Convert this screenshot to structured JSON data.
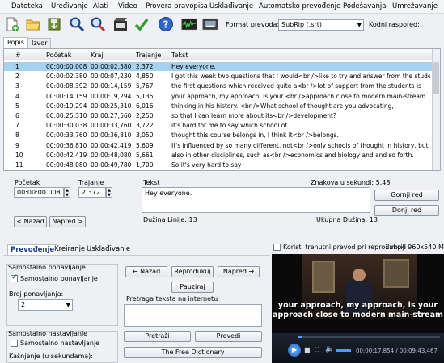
{
  "menu": [
    "Datoteka",
    "Uređivanje",
    "Alati",
    "Video",
    "Provera pravopisa",
    "Usklađivanje",
    "Automatsko prevođenje",
    "Podešavanja",
    "Umrežavanje"
  ],
  "toolbar": {
    "format_label": "Format prevoda:",
    "format_value": "SubRip (.srt)",
    "encoding_label": "Kodni raspored:",
    "icons": [
      "new-file-icon",
      "open-folder-icon",
      "save-icon",
      "find-icon",
      "replace-icon",
      "visual-sync-icon",
      "spell-check-icon",
      "help-icon",
      "waveform-icon",
      "video-icon"
    ]
  },
  "tabs": {
    "list": "Popis",
    "source": "Izvor"
  },
  "grid": {
    "headers": [
      "#",
      "Početak",
      "Kraj",
      "Trajanje",
      "Tekst"
    ],
    "rows": [
      [
        "1",
        "00:00:00,008",
        "00:00:02,380",
        "2,372",
        "Hey everyone."
      ],
      [
        "2",
        "00:00:02,380",
        "00:00:07,230",
        "4,850",
        "I got this week two questions that I would<br />like to try and answer from the students."
      ],
      [
        "3",
        "00:00:08,392",
        "00:00:14,159",
        "5,767",
        "the first questions which received quite a<br />lot of support from the students is"
      ],
      [
        "4",
        "00:00:14,159",
        "00:00:19,294",
        "5,135",
        "your approach, my approach, is your <br />approach close to modern main-stream"
      ],
      [
        "5",
        "00:00:19,294",
        "00:00:25,310",
        "6,016",
        "thinking in his history. <br />What school of thought are you advocating,"
      ],
      [
        "6",
        "00:00:25,310",
        "00:00:27,560",
        "2,250",
        "so that I can learn more about its<br />development?"
      ],
      [
        "7",
        "00:00:30,038",
        "00:00:33,760",
        "3,722",
        "it's hard for me to say which school of"
      ],
      [
        "8",
        "00:00:33,760",
        "00:00:36,810",
        "3,050",
        "thought this course belongs in, I think it<br />belongs."
      ],
      [
        "9",
        "00:00:36,810",
        "00:00:42,419",
        "5,609",
        "It's influenced by so many different, not<br />only schools of thought in history, but"
      ],
      [
        "10",
        "00:00:42,419",
        "00:00:48,080",
        "5,661",
        "also in other disciplines, such as<br />economics and biology and and so forth."
      ],
      [
        "11",
        "00:00:48,080",
        "00:00:49,780",
        "1,700",
        "So it's very hard to say"
      ]
    ]
  },
  "editor": {
    "start_label": "Početak",
    "start_value": "00:00:00.008",
    "duration_label": "Trajanje",
    "duration_value": "2.372",
    "text_label": "Tekst",
    "cps": "Znakova u sekundi: 5.48",
    "text_value": "Hey everyone.",
    "line_length": "Dužina Linije:  13",
    "total_length": "Ukupna Dužina:  13",
    "prev": "< Nazad",
    "next": "Napred >",
    "upper_row": "Gornji red",
    "lower_row": "Donji red"
  },
  "lower_tabs": [
    "Prevođenje",
    "Kreiranje",
    "Usklađivanje"
  ],
  "translate": {
    "repeat_group": "Samostalno ponavljanje",
    "repeat_check": "Samostalno ponavljanje",
    "repeat_count_label": "Broj ponavljanja:",
    "repeat_count": "2",
    "continue_group": "Samostalno nastavljanje",
    "continue_check": "Samostalno nastavljanje",
    "delay_label": "Kašnjenje (u sekundama):",
    "back_btn": "← Nazad",
    "play_btn": "Reprodukuj",
    "forward_btn": "Napred →",
    "pause_btn": "Pauziraj",
    "search_label": "Pretraga teksta na internetu",
    "search_btn": "Pretraži",
    "translate_btn": "Prevedi",
    "dictionary_btn": "The Free Dictionary"
  },
  "video": {
    "use_current": "Koristi trenutni prevod pri reprodukciji",
    "info": "1.mp4 960x540 MP4",
    "subtitle_line1": "your approach, my approach, is your",
    "subtitle_line2": "approach close to modern main-stream",
    "time": "00:00:17.854 / 00:09:43.467",
    "progress": 0.031
  },
  "colors": {
    "selection": "#a6d2ee",
    "accent": "#1b3d8f"
  }
}
